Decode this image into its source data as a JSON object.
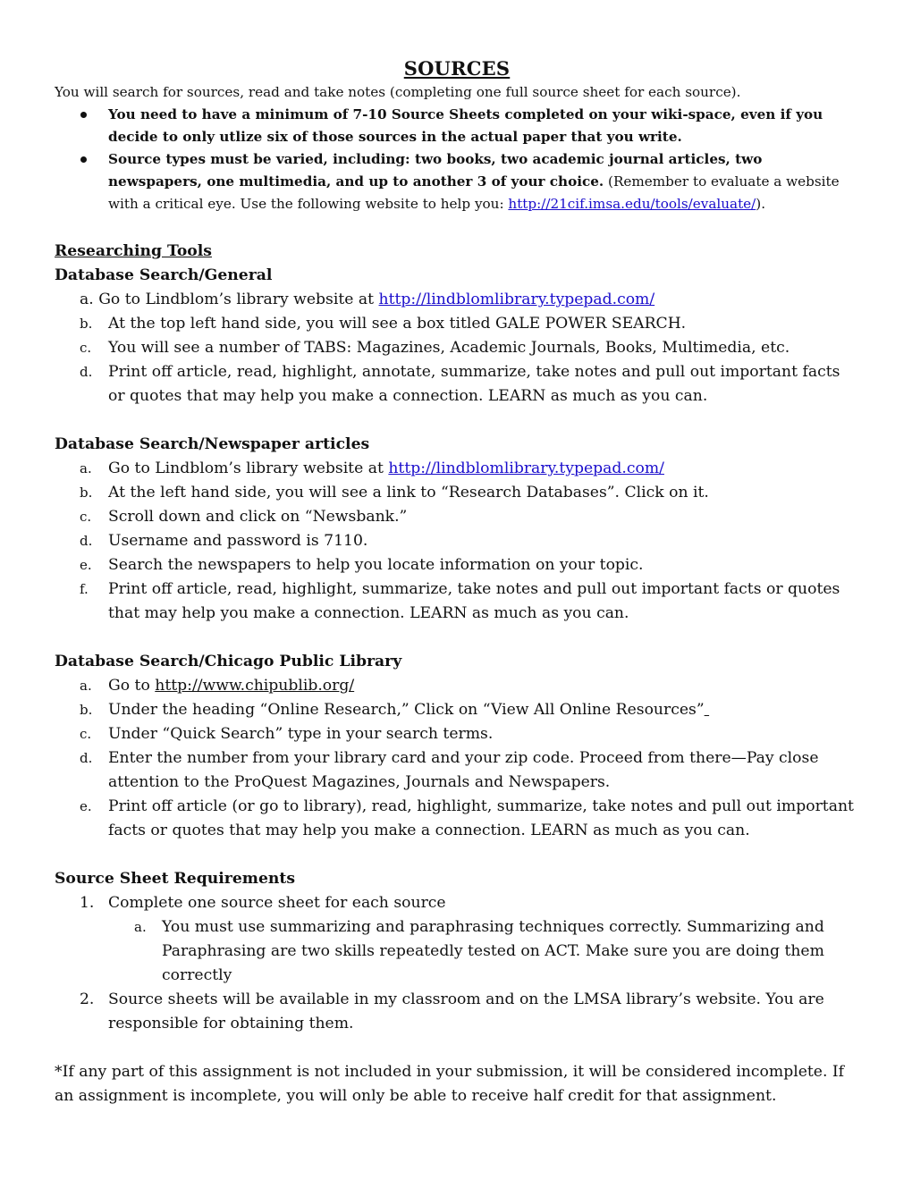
{
  "document": {
    "title": "SOURCES",
    "intro": "You will search for sources, read and take notes (completing one full source sheet for each source).",
    "bullets": [
      {
        "bold": "You need to have a minimum of 7-10 Source Sheets completed on your wiki-space, even if you decide to only utlize six of those sources in the actual paper that you write.",
        "normal_before_link": "",
        "link": "",
        "normal_after_link": ""
      },
      {
        "bold": "Source types must be varied, including:   two books, two academic journal articles, two newspapers, one multimedia, and up to another 3 of your choice.",
        "normal_before_link": " (Remember to evaluate a website with a critical eye. Use the following website to help you: ",
        "link": "http://21cif.imsa.edu/tools/evaluate/",
        "normal_after_link": ")."
      }
    ],
    "researching_tools_heading": "Researching Tools",
    "sections": [
      {
        "heading": "Database Search/General",
        "steps": [
          {
            "marker": "a.",
            "text": "Go to Lindblom’s library website at ",
            "link": "http://lindblomlibrary.typepad.com/"
          },
          {
            "marker": "b.",
            "text": "At the top left hand side, you will see a box titled GALE POWER SEARCH."
          },
          {
            "marker": "c.",
            "text": "You will see a number of TABS: Magazines, Academic Journals, Books, Multimedia, etc."
          },
          {
            "marker": "d.",
            "text": "Print off article, read, highlight, annotate, summarize, take notes and pull out important facts or quotes that may help you make a connection. LEARN as much as you can."
          }
        ]
      },
      {
        "heading": "Database Search/Newspaper articles",
        "steps": [
          {
            "marker": "a.",
            "text": "Go to Lindblom’s library website at ",
            "link": "http://lindblomlibrary.typepad.com/"
          },
          {
            "marker": "b.",
            "text": "At the left hand side, you will see a link to “Research Databases”. Click on it."
          },
          {
            "marker": "c.",
            "text": "Scroll down and click on “Newsbank.”"
          },
          {
            "marker": "d.",
            "text": "Username and password is 7110."
          },
          {
            "marker": "e.",
            "text": "Search the newspapers to help you locate information on your topic."
          },
          {
            "marker": "f.",
            "text": "Print off article, read, highlight, summarize, take notes and pull out important facts or quotes that may help you make a connection. LEARN as much as you can."
          }
        ]
      },
      {
        "heading": "Database Search/Chicago Public Library",
        "steps": [
          {
            "marker": "a.",
            "text": "Go to ",
            "link": "http://www.chipublib.org/"
          },
          {
            "marker": "b.",
            "text": "Under the  heading “Online Research,” Click on “View All Online Resources”"
          },
          {
            "marker": "c.",
            "text": "Under “Quick Search” type in your search terms."
          },
          {
            "marker": "d.",
            "text": "Enter the number from your library card and your zip code. Proceed from there—Pay close attention to the ProQuest Magazines, Journals and Newspapers."
          },
          {
            "marker": "e.",
            "text": "Print off article (or go to library), read, highlight, summarize, take notes and pull out important facts or quotes that may help you make a connection. LEARN as much as you can."
          }
        ]
      }
    ],
    "requirements": {
      "heading": "Source Sheet Requirements",
      "items": [
        {
          "marker": "1.",
          "text": "Complete one source sheet for each source",
          "sub": [
            {
              "marker": "a.",
              "text": "You must use summarizing and paraphrasing techniques correctly. Summarizing and Paraphrasing are two skills repeatedly tested on ACT. Make sure you are doing them correctly"
            }
          ]
        },
        {
          "marker": "2.",
          "text": "Source sheets will be available in my classroom and on the LMSA library’s website. You are responsible for obtaining them."
        }
      ]
    },
    "footnote": "*If any part of this assignment is not included in your submission, it will be considered incomplete. If an assignment is incomplete, you will only be able to receive half credit for that assignment."
  },
  "colors": {
    "link": "#1a0dcc",
    "text": "#111111"
  }
}
